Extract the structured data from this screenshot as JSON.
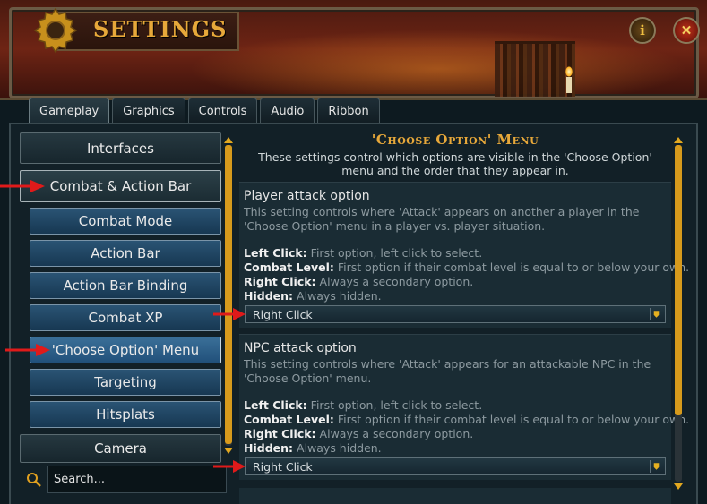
{
  "window": {
    "title": "SETTINGS",
    "info_button_glyph": "i",
    "close_button_glyph": "✕"
  },
  "tabs": [
    {
      "label": "Gameplay",
      "active": true
    },
    {
      "label": "Graphics",
      "active": false
    },
    {
      "label": "Controls",
      "active": false
    },
    {
      "label": "Audio",
      "active": false
    },
    {
      "label": "Ribbon",
      "active": false
    }
  ],
  "sidebar": {
    "items": [
      {
        "label": "Interfaces",
        "level": "top"
      },
      {
        "label": "Combat & Action Bar",
        "level": "top",
        "selected": true
      },
      {
        "label": "Combat Mode",
        "level": "sub"
      },
      {
        "label": "Action Bar",
        "level": "sub"
      },
      {
        "label": "Action Bar Binding",
        "level": "sub"
      },
      {
        "label": "Combat XP",
        "level": "sub"
      },
      {
        "label": "'Choose Option' Menu",
        "level": "sub",
        "selected": true
      },
      {
        "label": "Targeting",
        "level": "sub"
      },
      {
        "label": "Hitsplats",
        "level": "sub"
      },
      {
        "label": "Camera",
        "level": "top"
      }
    ]
  },
  "search": {
    "placeholder": "Search...",
    "icon": "search-icon"
  },
  "main": {
    "title": "'Choose Option' Menu",
    "description": "These settings control which options are visible in the 'Choose Option' menu and the order that they appear in.",
    "sections": [
      {
        "title": "Player attack option",
        "description": "This setting controls where 'Attack' appears on another a player in the 'Choose Option' menu in a player vs. player situation.",
        "options": [
          {
            "term": "Left Click:",
            "text": "First option, left click to select."
          },
          {
            "term": "Combat Level:",
            "text": "First option if their combat level is equal to or below your own."
          },
          {
            "term": "Right Click:",
            "text": "Always a secondary option."
          },
          {
            "term": "Hidden:",
            "text": "Always hidden."
          }
        ],
        "selected_value": "Right Click"
      },
      {
        "title": "NPC attack option",
        "description": "This setting controls where 'Attack' appears for an attackable NPC in the 'Choose Option' menu.",
        "options": [
          {
            "term": "Left Click:",
            "text": "First option, left click to select."
          },
          {
            "term": "Combat Level:",
            "text": "First option if their combat level is equal to or below your own."
          },
          {
            "term": "Right Click:",
            "text": "Always a secondary option."
          },
          {
            "term": "Hidden:",
            "text": "Always hidden."
          }
        ],
        "selected_value": "Right Click"
      }
    ]
  },
  "colors": {
    "accent_gold": "#e7a83a",
    "scroll_thumb": "#d79a1c",
    "annotation_arrow": "#e01a1a"
  }
}
